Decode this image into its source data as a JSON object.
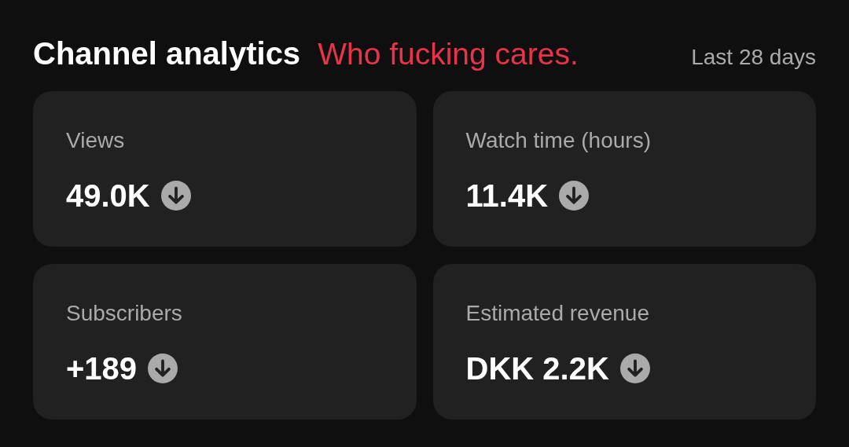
{
  "header": {
    "title": "Channel analytics",
    "caption": "Who fucking cares.",
    "period": "Last 28 days"
  },
  "metrics": [
    {
      "label": "Views",
      "value": "49.0K",
      "decreasing": true
    },
    {
      "label": "Watch time (hours)",
      "value": "11.4K",
      "decreasing": true
    },
    {
      "label": "Subscribers",
      "value": "+189",
      "decreasing": true
    },
    {
      "label": "Estimated revenue",
      "value": "DKK 2.2K",
      "decreasing": true
    }
  ]
}
